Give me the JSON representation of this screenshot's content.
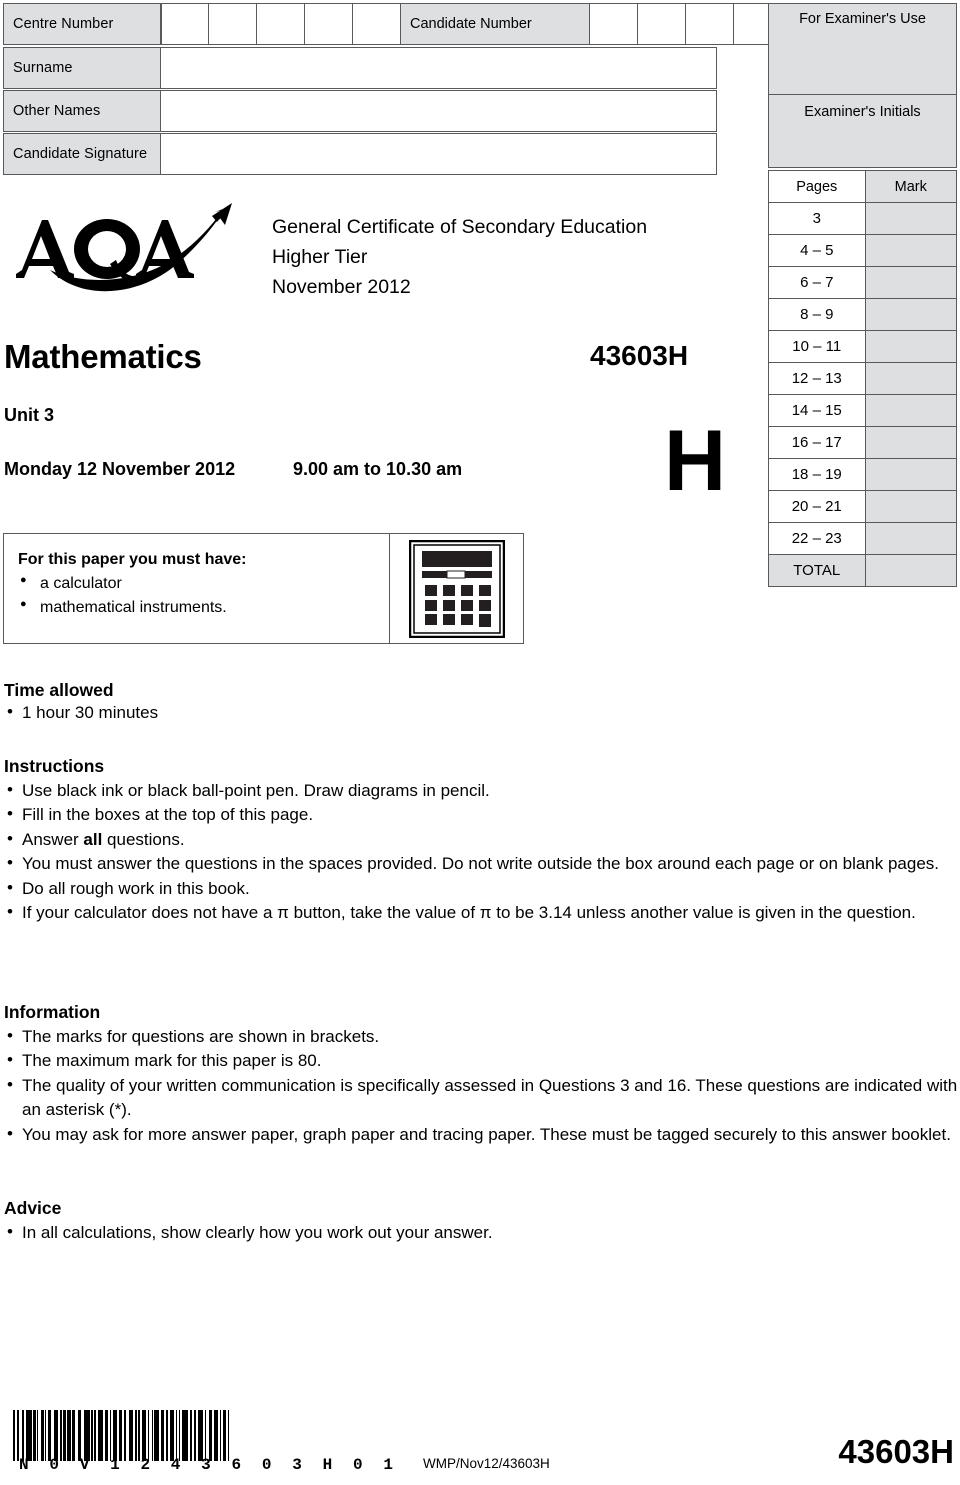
{
  "candidate_details": {
    "centre_number_label": "Centre Number",
    "candidate_number_label": "Candidate Number",
    "surname_label": "Surname",
    "other_names_label": "Other Names",
    "candidate_signature_label": "Candidate Signature",
    "centre_number_value": "",
    "candidate_number_value": "",
    "surname_value": "",
    "other_names_value": "",
    "candidate_signature_value": "",
    "centre_boxes": 5,
    "candidate_boxes": 4
  },
  "examiner": {
    "title": "For Examiner's Use",
    "initials_label": "Examiner's Initials",
    "col_pages": "Pages",
    "col_mark": "Mark",
    "rows": [
      {
        "pages": "3",
        "mark": ""
      },
      {
        "pages": "4 – 5",
        "mark": ""
      },
      {
        "pages": "6 – 7",
        "mark": ""
      },
      {
        "pages": "8 – 9",
        "mark": ""
      },
      {
        "pages": "10 – 11",
        "mark": ""
      },
      {
        "pages": "12 – 13",
        "mark": ""
      },
      {
        "pages": "14 – 15",
        "mark": ""
      },
      {
        "pages": "16 – 17",
        "mark": ""
      },
      {
        "pages": "18 – 19",
        "mark": ""
      },
      {
        "pages": "20 – 21",
        "mark": ""
      },
      {
        "pages": "22 – 23",
        "mark": ""
      }
    ],
    "total_label": "TOTAL",
    "total_mark": ""
  },
  "header": {
    "logo_text": "AQA",
    "qualification": "General Certificate of Secondary Education",
    "tier": "Higher Tier",
    "session": "November 2012",
    "subject": "Mathematics",
    "paper_code": "43603H",
    "unit": "Unit 3",
    "exam_date": "Monday 12 November 2012",
    "exam_time": "9.00 am to 10.30 am",
    "tier_letter": "H"
  },
  "requirements": {
    "title": "For this paper you must have:",
    "items": [
      "a calculator",
      "mathematical instruments."
    ]
  },
  "time_allowed": {
    "title": "Time allowed",
    "items": [
      "1 hour 30 minutes"
    ]
  },
  "instructions": {
    "title": "Instructions",
    "items": [
      "Use black ink or black ball-point pen.  Draw diagrams in pencil.",
      "Fill in the boxes at the top of this page.",
      "Answer all questions.",
      "You must answer the questions in the spaces provided.  Do not write outside the box around each page or on blank pages.",
      "Do all rough work in this book.",
      "If your calculator does not have a π button, take the value of π to be 3.14 unless another value is given in the question."
    ]
  },
  "information": {
    "title": "Information",
    "items": [
      "The marks for questions are shown in brackets.",
      "The maximum mark for this paper is 80.",
      "The quality of your written communication is specifically assessed in Questions 3 and 16.  These questions are indicated with an asterisk (*).",
      "You may ask for more answer paper, graph paper and tracing paper. These must be tagged securely to this answer booklet."
    ]
  },
  "advice": {
    "title": "Advice",
    "items": [
      "In all calculations, show clearly how you work out your answer."
    ]
  },
  "footer": {
    "barcode_digits": "N0V1243603H01",
    "wmp_code": "WMP/Nov12/43603H",
    "paper_code": "43603H"
  },
  "colors": {
    "shade": "#dedfe1",
    "rule": "#58595b",
    "ink": "#000000"
  }
}
